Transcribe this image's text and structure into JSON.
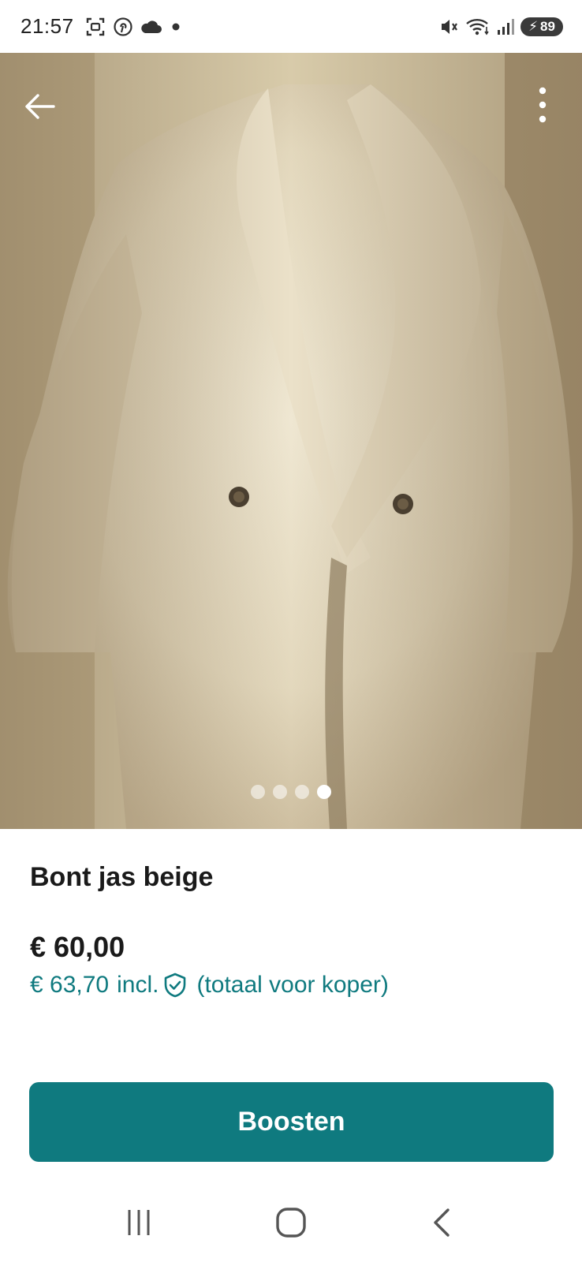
{
  "status_bar": {
    "time": "21:57",
    "battery": "89",
    "icons_left": [
      "screenshot-icon",
      "pinterest-icon",
      "cloud-icon",
      "dot-icon"
    ],
    "icons_right": [
      "mute-icon",
      "wifi-icon",
      "signal-icon",
      "battery-icon"
    ]
  },
  "photo": {
    "alt": "beige faux fur coat",
    "carousel": {
      "count": 4,
      "active_index": 3
    }
  },
  "listing": {
    "title": "Bont jas beige",
    "price": "€ 60,00",
    "price_incl": "€ 63,70",
    "incl_label": "incl.",
    "incl_note": "(totaal voor koper)"
  },
  "actions": {
    "boost_label": "Boosten"
  },
  "colors": {
    "accent": "#0f7a7f",
    "text": "#1a1a1a"
  }
}
